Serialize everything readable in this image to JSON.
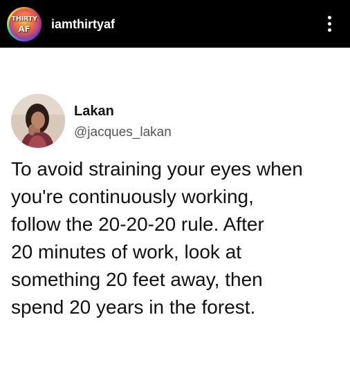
{
  "header": {
    "account_avatar_text_line1": "THIRTY",
    "account_avatar_text_line2": "AF",
    "username": "iamthirtyaf",
    "more_icon": "more-vertical-icon"
  },
  "tweet": {
    "author_name": "Lakan",
    "author_handle": "@jacques_lakan",
    "text": "To avoid straining your eyes when\nyou're continuously working,\nfollow the 20-20-20 rule. After\n20 minutes of work, look at\nsomething 20 feet away, then\nspend 20 years in the forest."
  },
  "colors": {
    "header_background": "#000000",
    "page_background": "#ffffff",
    "text_primary": "#111111",
    "text_secondary": "#555555"
  }
}
